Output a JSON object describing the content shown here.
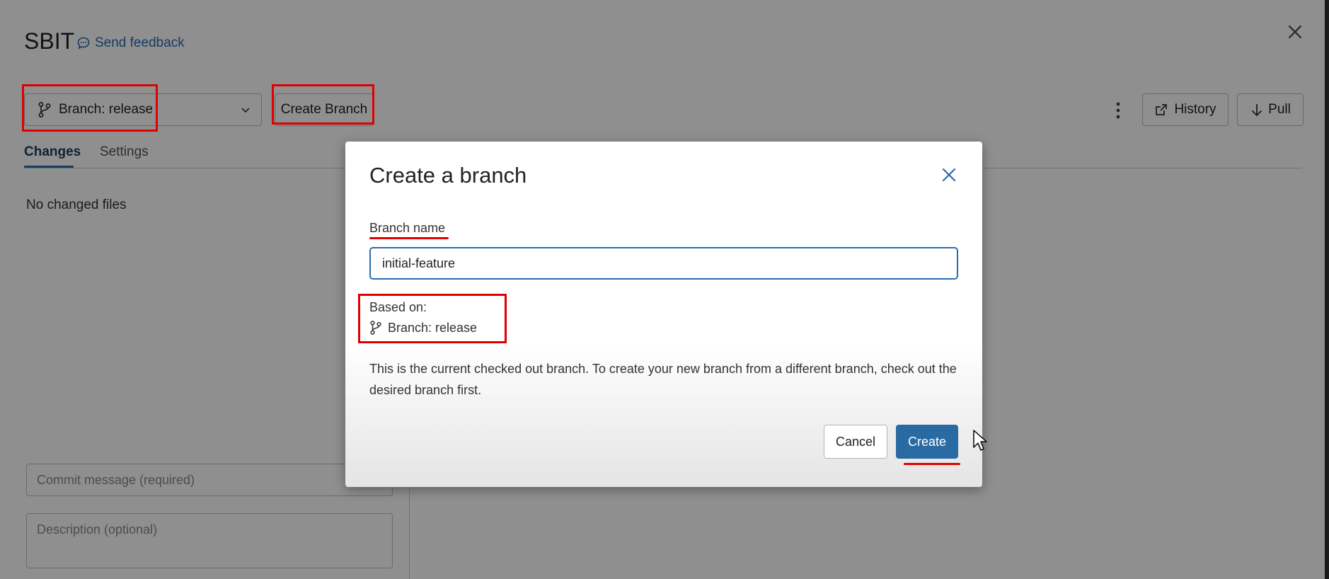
{
  "app": {
    "title": "SBIT",
    "feedback_label": "Send feedback"
  },
  "toolbar": {
    "branch_label": "Branch: release",
    "create_branch_label": "Create Branch",
    "history_label": "History",
    "pull_label": "Pull"
  },
  "tabs": [
    {
      "label": "Changes",
      "active": true
    },
    {
      "label": "Settings",
      "active": false
    }
  ],
  "changes": {
    "empty_text": "No changed files",
    "commit_placeholder": "Commit message (required)",
    "description_placeholder": "Description (optional)"
  },
  "dialog": {
    "title": "Create a branch",
    "field_label": "Branch name",
    "branch_name_value": "initial-feature",
    "based_on_label": "Based on:",
    "based_on_branch": "Branch: release",
    "helper_text": "This is the current checked out branch. To create your new branch from a different branch, check out the desired branch first.",
    "cancel_label": "Cancel",
    "create_label": "Create"
  },
  "colors": {
    "accent": "#2b6cb0",
    "primary_button": "#2a6aa3",
    "annotation": "#e00000"
  }
}
